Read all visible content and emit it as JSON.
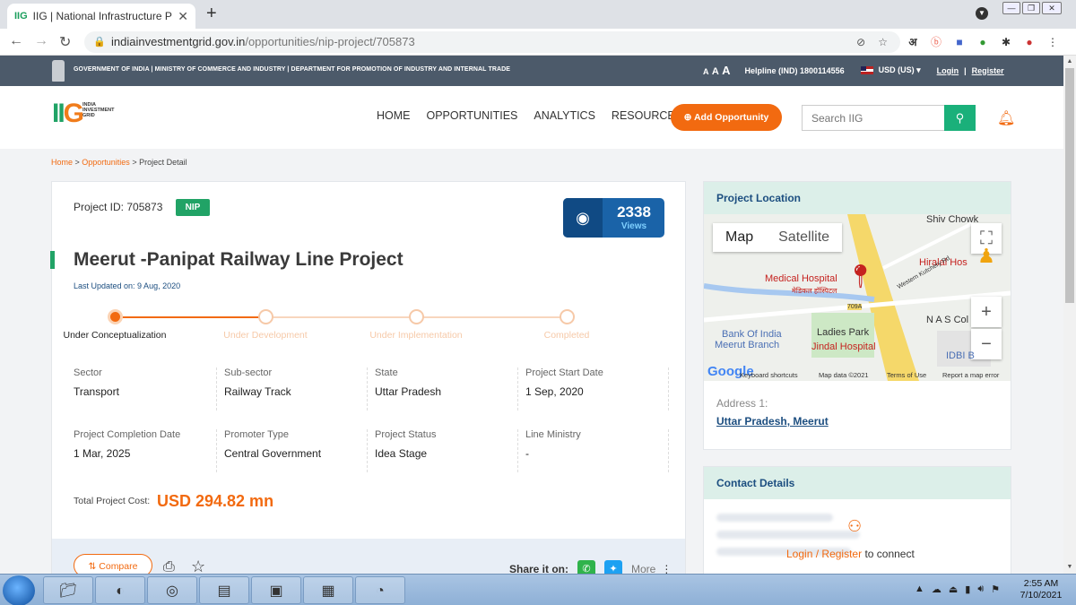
{
  "browser": {
    "tab_title": "IIG | National Infrastructure Pipeli",
    "tab_favicon": "IIG",
    "url_domain": "indiainvestmentgrid.gov.in",
    "url_path": "/opportunities/nip-project/705873"
  },
  "govbar": {
    "text": "GOVERNMENT OF INDIA | MINISTRY OF COMMERCE AND INDUSTRY | DEPARTMENT FOR PROMOTION OF INDUSTRY AND INTERNAL TRADE",
    "font_sizes": [
      "A",
      "A",
      "A"
    ],
    "helpline": "Helpline (IND) 1800114556",
    "currency": "USD (US)",
    "login": "Login",
    "sep": "|",
    "register": "Register"
  },
  "header": {
    "logo_text": "IIG",
    "logo_sub": [
      "INDIA",
      "INVESTMENT",
      "GRID"
    ],
    "nav": [
      "HOME",
      "OPPORTUNITIES",
      "ANALYTICS",
      "RESOURCES"
    ],
    "add_opportunity": "Add Opportunity",
    "search_placeholder": "Search IIG"
  },
  "breadcrumb": {
    "home": "Home",
    "opportunities": "Opportunities",
    "current": "Project Detail"
  },
  "project": {
    "id_label": "Project ID: 705873",
    "badge": "NIP",
    "views_count": "2338",
    "views_label": "Views",
    "title": "Meerut -Panipat Railway Line Project",
    "last_updated": "Last Updated on: 9 Aug, 2020",
    "stages": [
      "Under Conceptualization",
      "Under Development",
      "Under Implementation",
      "Completed"
    ],
    "current_stage_index": 0,
    "details": [
      {
        "label": "Sector",
        "value": "Transport"
      },
      {
        "label": "Sub-sector",
        "value": "Railway Track"
      },
      {
        "label": "State",
        "value": "Uttar Pradesh"
      },
      {
        "label": "Project Start Date",
        "value": "1 Sep, 2020"
      },
      {
        "label": "Project Completion Date",
        "value": "1 Mar, 2025"
      },
      {
        "label": "Promoter Type",
        "value": "Central Government"
      },
      {
        "label": "Project Status",
        "value": "Idea Stage"
      },
      {
        "label": "Line Ministry",
        "value": "-"
      }
    ],
    "cost_label": "Total Project Cost:",
    "cost_value": "USD 294.82 mn",
    "compare": "Compare",
    "share_label": "Share it on:",
    "more": "More"
  },
  "location": {
    "heading": "Project Location",
    "map_tab": "Map",
    "satellite_tab": "Satellite",
    "labels": {
      "shiv_chowk": "Shiv Chowk",
      "medical": "Medical Hospital",
      "medical_hi": "मेडिकल हॉस्पिटल",
      "hiralal": "Hiralal Hos",
      "road_709a": "709A",
      "nas": "N A S Col",
      "ladies_park": "Ladies Park",
      "jindal": "Jindal Hospital",
      "bank": "Bank Of India",
      "bank2": "Meerut Branch",
      "idbi": "IDBI B",
      "western": "Western Kutchery Rd"
    },
    "footer": [
      "Keyboard shortcuts",
      "Map data ©2021",
      "Terms of Use",
      "Report a map error"
    ],
    "google": "Google",
    "address_label": "Address 1:",
    "address_value": "Uttar Pradesh, Meerut"
  },
  "contact": {
    "heading": "Contact Details",
    "login": "Login",
    "register": "Register",
    "connect": "to connect"
  },
  "taskbar": {
    "time": "2:55 AM",
    "date": "7/10/2021"
  }
}
